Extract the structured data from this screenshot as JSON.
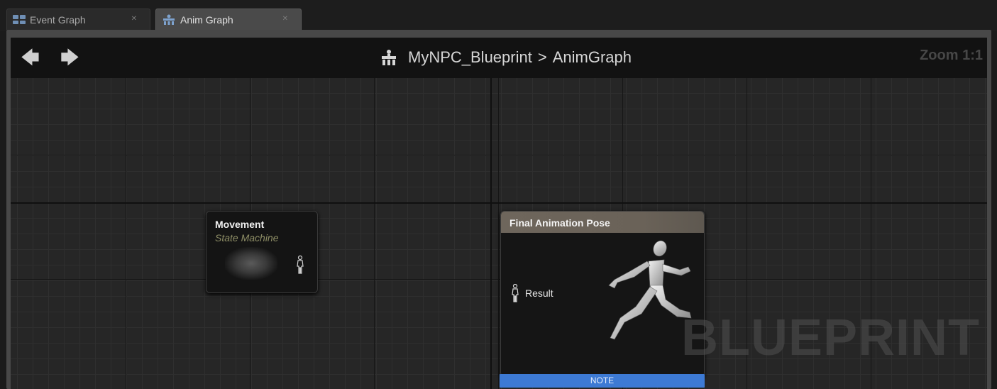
{
  "tabs": [
    {
      "label": "Event Graph",
      "icon": "event-graph-icon",
      "active": false
    },
    {
      "label": "Anim Graph",
      "icon": "anim-graph-icon",
      "active": true
    }
  ],
  "header": {
    "back": "back-arrow-icon",
    "forward": "forward-arrow-icon",
    "breadcrumb_icon": "anim-blueprint-icon",
    "blueprint_name": "MyNPC_Blueprint",
    "separator": ">",
    "graph_name": "AnimGraph",
    "zoom": "Zoom 1:1"
  },
  "nodes": {
    "movement": {
      "title": "Movement",
      "subtitle": "State Machine",
      "pin_icon": "pose-pin-icon"
    },
    "final_pose": {
      "title": "Final Animation Pose",
      "pin_label": "Result",
      "pin_icon": "pose-pin-icon",
      "image": "running-mannequin-icon"
    }
  },
  "note": "NOTE",
  "watermark": "BLUEPRINT",
  "colors": {
    "note_bar": "#3d7ad4",
    "final_header": "#6e665c",
    "subtitle": "#8e8e66"
  }
}
